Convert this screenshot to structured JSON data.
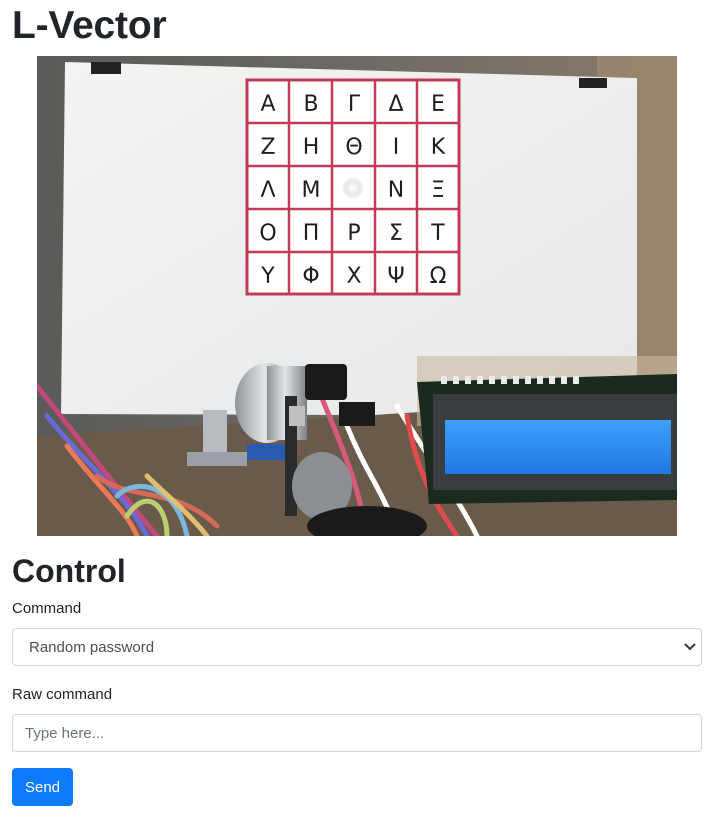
{
  "header": {
    "title": "L-Vector"
  },
  "camera": {
    "grid_letters": [
      [
        "Α",
        "Β",
        "Γ",
        "Δ",
        "Ε"
      ],
      [
        "Ζ",
        "Η",
        "Θ",
        "Ι",
        "Κ"
      ],
      [
        "Λ",
        "Μ",
        "",
        "Ν",
        "Ξ"
      ],
      [
        "Ο",
        "Π",
        "Ρ",
        "Σ",
        "Τ"
      ],
      [
        "Υ",
        "Φ",
        "Χ",
        "Ψ",
        "Ω"
      ]
    ]
  },
  "control": {
    "title": "Control",
    "command_label": "Command",
    "command_selected": "Random password",
    "raw_label": "Raw command",
    "raw_placeholder": "Type here...",
    "send_label": "Send"
  },
  "colors": {
    "primary": "#0d7bfd",
    "grid_border": "#c43a55",
    "lcd_blue": "#2a8cf0"
  }
}
